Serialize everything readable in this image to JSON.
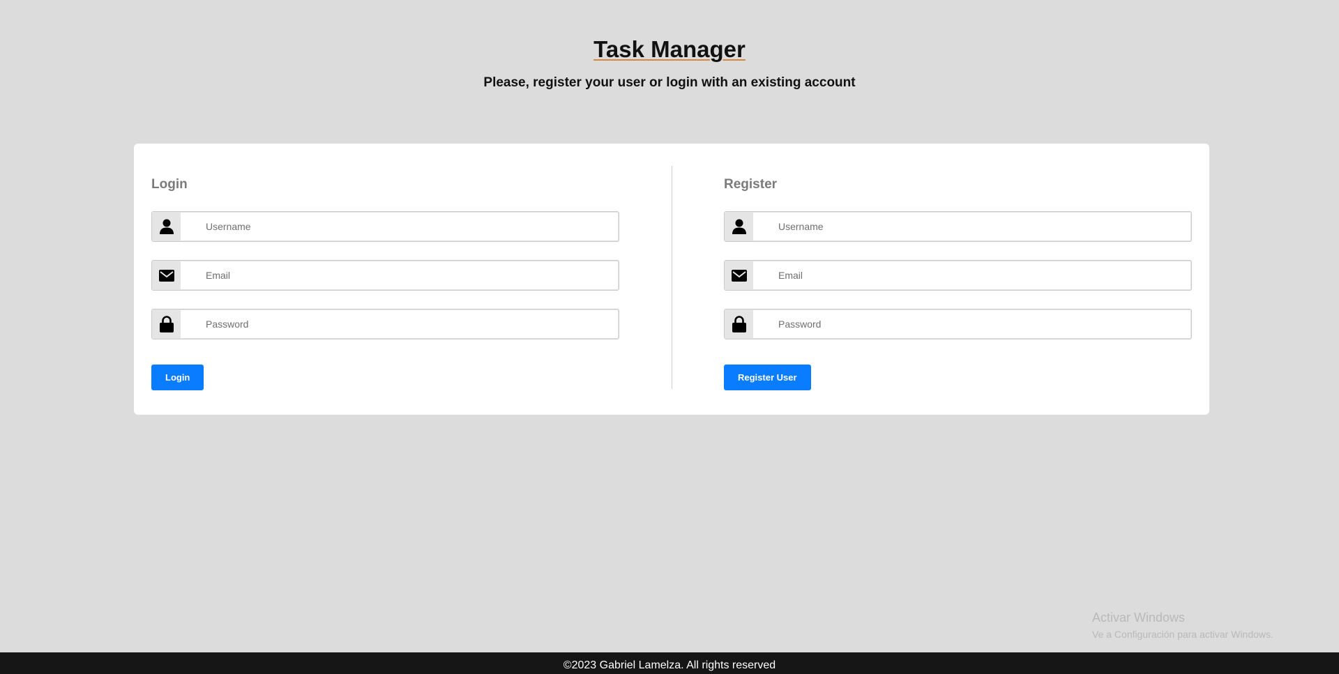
{
  "header": {
    "title": "Task Manager",
    "subtitle": "Please, register your user or login with an existing account"
  },
  "login": {
    "title": "Login",
    "username_placeholder": "Username",
    "email_placeholder": "Email",
    "password_placeholder": "Password",
    "button_label": "Login"
  },
  "register": {
    "title": "Register",
    "username_placeholder": "Username",
    "email_placeholder": "Email",
    "password_placeholder": "Password",
    "button_label": "Register User"
  },
  "icons": {
    "username": "user-icon",
    "email": "envelope-icon",
    "password": "lock-icon"
  },
  "colors": {
    "primary_button": "#0a7cff",
    "title_underline": "#d7873d",
    "footer_bg": "#161616"
  },
  "watermark": {
    "title": "Activar Windows",
    "subtitle": "Ve a Configuración para activar Windows."
  },
  "footer": {
    "text": "©2023 Gabriel Lamelza. All rights reserved"
  }
}
